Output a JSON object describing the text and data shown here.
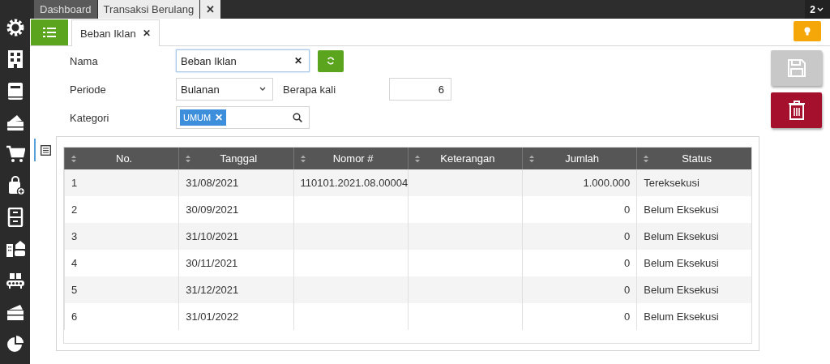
{
  "top_tabs": [
    {
      "label": "Dashboard",
      "selected": false
    },
    {
      "label": "Transaksi Berulang",
      "selected": true
    }
  ],
  "top_close": "✕",
  "window_count": "2",
  "doc_tabs": [
    {
      "label": "Beban Iklan",
      "selected": true,
      "close": "✕"
    }
  ],
  "form": {
    "nama": {
      "label": "Nama",
      "value": "Beban Iklan",
      "clear": "✕"
    },
    "periode": {
      "label": "Periode",
      "value": "Bulanan"
    },
    "berapa_kali": {
      "label": "Berapa kali",
      "value": "6"
    },
    "kategori": {
      "label": "Kategori",
      "tags": [
        {
          "label": "UMUM",
          "remove": "✕"
        }
      ]
    }
  },
  "table": {
    "columns": [
      "No.",
      "Tanggal",
      "Nomor #",
      "Keterangan",
      "Jumlah",
      "Status"
    ],
    "rows": [
      [
        "1",
        "31/08/2021",
        "110101.2021.08.00004",
        "",
        "1.000.000",
        "Tereksekusi"
      ],
      [
        "2",
        "30/09/2021",
        "",
        "",
        "0",
        "Belum Eksekusi"
      ],
      [
        "3",
        "31/10/2021",
        "",
        "",
        "0",
        "Belum Eksekusi"
      ],
      [
        "4",
        "30/11/2021",
        "",
        "",
        "0",
        "Belum Eksekusi"
      ],
      [
        "5",
        "31/12/2021",
        "",
        "",
        "0",
        "Belum Eksekusi"
      ],
      [
        "6",
        "31/01/2022",
        "",
        "",
        "0",
        "Belum Eksekusi"
      ]
    ]
  },
  "actions": [
    {
      "kind": "save",
      "disabled": true
    },
    {
      "kind": "delete",
      "disabled": false
    }
  ]
}
